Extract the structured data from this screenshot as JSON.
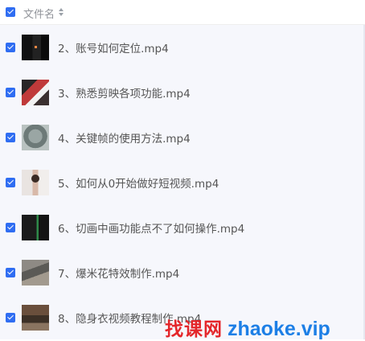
{
  "header": {
    "label": "文件名",
    "sort_icon": "sort-icon",
    "select_all_checked": true
  },
  "files": [
    {
      "name": "2、账号如何定位.mp4",
      "checked": true
    },
    {
      "name": "3、熟悉剪映各项功能.mp4",
      "checked": true
    },
    {
      "name": "4、关键帧的使用方法.mp4",
      "checked": true
    },
    {
      "name": "5、如何从0开始做好短视频.mp4",
      "checked": true
    },
    {
      "name": "6、切画中画功能点不了如何操作.mp4",
      "checked": true
    },
    {
      "name": "7、爆米花特效制作.mp4",
      "checked": true
    },
    {
      "name": "8、隐身衣视频教程制作.mp4",
      "checked": true
    }
  ],
  "watermark": {
    "cn": "找课网",
    "url": "zhaoke.vip"
  },
  "colors": {
    "accent": "#2f6df2",
    "watermark_red": "#e4262a",
    "watermark_blue": "#1d7fe6"
  }
}
